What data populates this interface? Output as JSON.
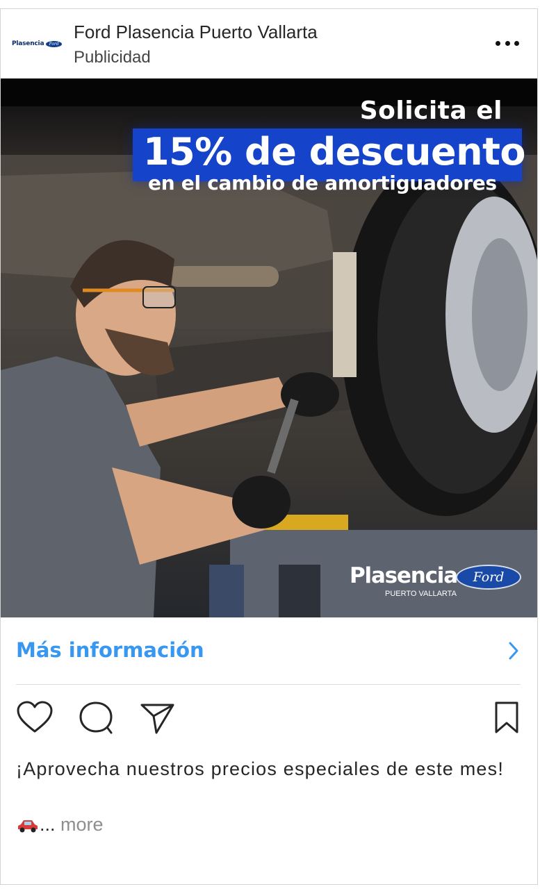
{
  "post": {
    "account_name": "Ford Plasencia Puerto Vallarta",
    "sponsored_label": "Publicidad",
    "avatar_brand": "Plasencia",
    "avatar_oval": "Ford"
  },
  "ad_image": {
    "line1": "Solicita el",
    "line2": "15% de descuento",
    "line3": "en el cambio de amortiguadores",
    "logo_brand": "Plasencia",
    "logo_sub": "PUERTO VALLARTA",
    "logo_oval": "Ford",
    "accent_color": "#1543c9"
  },
  "cta": {
    "label": "Más información",
    "color": "#3897f0"
  },
  "actions": {
    "like": "heart-icon",
    "comment": "comment-icon",
    "share": "share-icon",
    "save": "bookmark-icon"
  },
  "caption": {
    "text": "¡Aprovecha nuestros precios especiales de este mes!",
    "ellipsis": "...",
    "more": "more",
    "emoji": "car-icon"
  }
}
